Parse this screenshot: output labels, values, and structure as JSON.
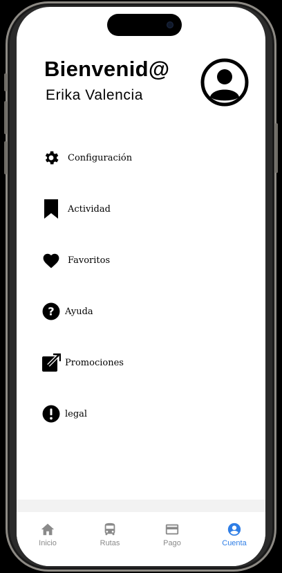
{
  "header": {
    "greeting": "Bienvenid@",
    "user_name": "Erika Valencia",
    "avatar_icon": "user-circle-icon"
  },
  "menu": {
    "items": [
      {
        "label": "Configuración",
        "icon": "gear-icon"
      },
      {
        "label": "Actividad",
        "icon": "bookmark-icon"
      },
      {
        "label": "Favoritos",
        "icon": "heart-icon"
      },
      {
        "label": "Ayuda",
        "icon": "help-circle-icon"
      },
      {
        "label": "Promociones",
        "icon": "external-link-icon"
      },
      {
        "label": "legal",
        "icon": "alert-circle-icon"
      }
    ]
  },
  "tabbar": {
    "active_color": "#2f7ee6",
    "inactive_color": "#8a8a8a",
    "tabs": [
      {
        "label": "Inicio",
        "icon": "home-icon"
      },
      {
        "label": "Rutas",
        "icon": "bus-icon"
      },
      {
        "label": "Pago",
        "icon": "credit-card-icon"
      },
      {
        "label": "Cuenta",
        "icon": "account-circle-icon",
        "active": true
      }
    ]
  }
}
